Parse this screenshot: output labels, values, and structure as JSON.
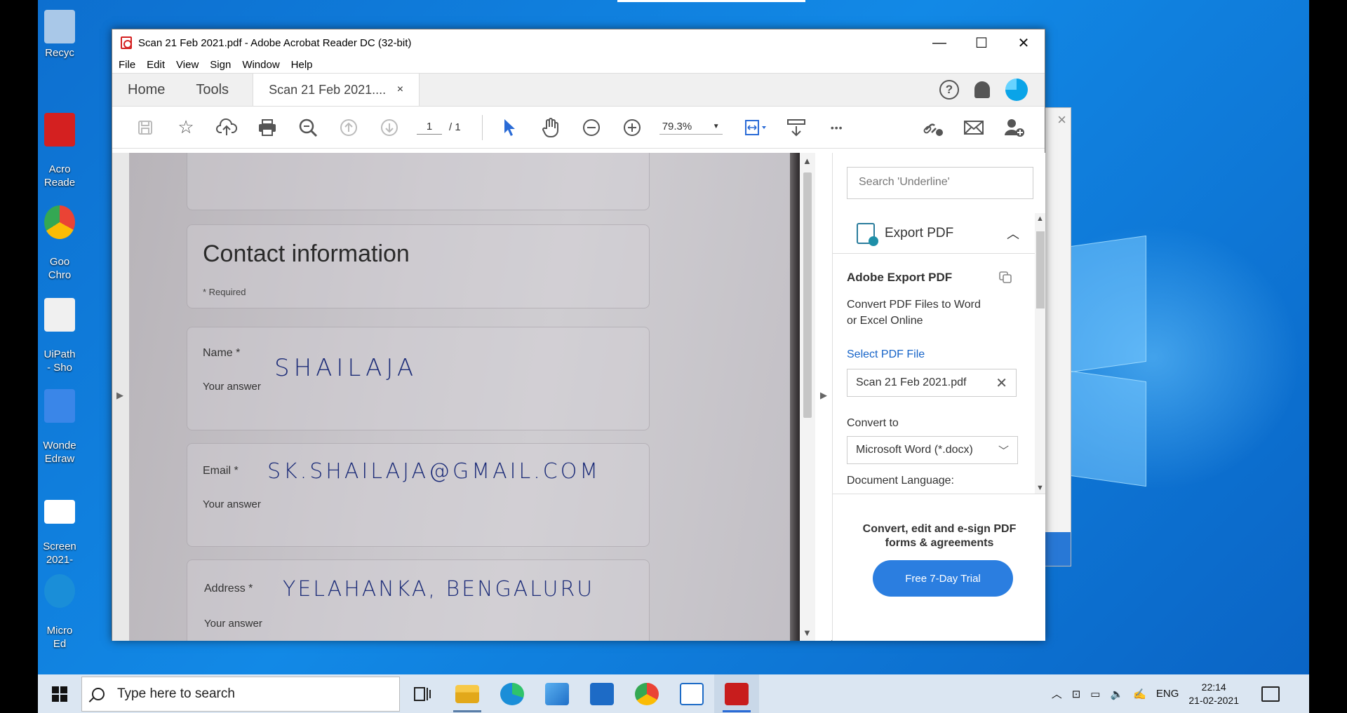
{
  "desktop": {
    "icons": [
      {
        "label": "Recyc",
        "color": "#a9c8e8"
      },
      {
        "label": "Acro\nReade",
        "color": "#d42020"
      },
      {
        "label": "Goo\nChro",
        "color": "#34a853"
      },
      {
        "label": "UiPath\n- Sho",
        "color": "#f0f0f0"
      },
      {
        "label": "Wonde\nEdraw",
        "color": "#3a86e8"
      },
      {
        "label": "Screen\n2021-",
        "color": "#ffffff"
      },
      {
        "label": "Micro\nEd",
        "color": "#1a8ed8"
      }
    ]
  },
  "window": {
    "title": "Scan 21 Feb 2021.pdf - Adobe Acrobat Reader DC (32-bit)",
    "minimize": "—",
    "maximize": "☐",
    "close": "✕"
  },
  "menu": [
    "File",
    "Edit",
    "View",
    "Sign",
    "Window",
    "Help"
  ],
  "tabs": {
    "home": "Home",
    "tools": "Tools",
    "doc": "Scan 21 Feb 2021....",
    "doc_close": "×",
    "help": "?"
  },
  "toolbar": {
    "page_current": "1",
    "page_total": "/ 1",
    "zoom": "79.3%",
    "more": "•••"
  },
  "document": {
    "heading": "Contact information",
    "required": "* Required",
    "fields": [
      {
        "label": "Name *",
        "answer_hint": "Your answer",
        "value": "SHAILAJA"
      },
      {
        "label": "Email *",
        "answer_hint": "Your answer",
        "value": "SK.SHAILAJA@GMAIL.COM"
      },
      {
        "label": "Address *",
        "answer_hint": "Your answer",
        "value": "YELAHANKA, BENGALURU"
      }
    ]
  },
  "right_panel": {
    "search_placeholder": "Search 'Underline'",
    "section_title": "Export PDF",
    "export_title": "Adobe Export PDF",
    "export_desc_1": "Convert PDF Files to Word",
    "export_desc_2": "or Excel Online",
    "select_link": "Select PDF File",
    "selected_file": "Scan 21 Feb 2021.pdf",
    "convert_to_label": "Convert to",
    "convert_to_value": "Microsoft Word (*.docx)",
    "doc_language_label": "Document Language:",
    "promo_1": "Convert, edit and e-sign PDF",
    "promo_2": "forms & agreements",
    "trial_button": "Free 7-Day Trial"
  },
  "taskbar": {
    "search_placeholder": "Type here to search",
    "language": "ENG",
    "time": "22:14",
    "date": "21-02-2021"
  }
}
